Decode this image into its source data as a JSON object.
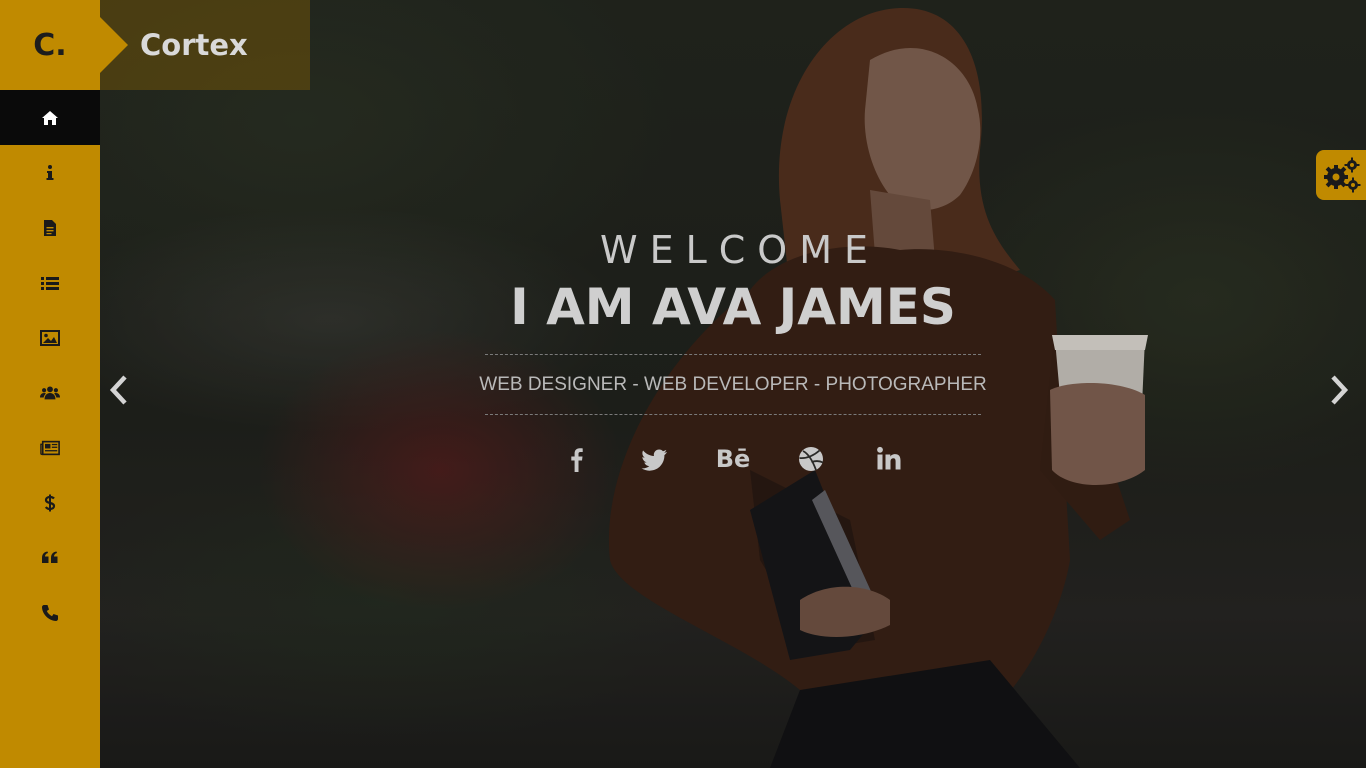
{
  "brand": {
    "logo_letter": "C.",
    "name": "Cortex"
  },
  "sidebar": {
    "items": [
      {
        "icon": "home-icon",
        "active": true
      },
      {
        "icon": "info-icon",
        "active": false
      },
      {
        "icon": "file-icon",
        "active": false
      },
      {
        "icon": "list-icon",
        "active": false
      },
      {
        "icon": "image-icon",
        "active": false
      },
      {
        "icon": "users-icon",
        "active": false
      },
      {
        "icon": "newspaper-icon",
        "active": false
      },
      {
        "icon": "dollar-icon",
        "active": false
      },
      {
        "icon": "quote-icon",
        "active": false
      },
      {
        "icon": "phone-icon",
        "active": false
      }
    ]
  },
  "hero": {
    "welcome": "WELCOME",
    "title": "I AM AVA JAMES",
    "roles": "WEB DESIGNER - WEB DEVELOPER - PHOTOGRAPHER",
    "social": [
      {
        "icon": "facebook-icon"
      },
      {
        "icon": "twitter-icon"
      },
      {
        "icon": "behance-icon",
        "label": "Bē"
      },
      {
        "icon": "dribbble-icon"
      },
      {
        "icon": "linkedin-icon"
      }
    ]
  },
  "colors": {
    "accent": "#c08a00",
    "sidebar_active": "#0a0a0a",
    "text_light": "#cfcfcf"
  }
}
